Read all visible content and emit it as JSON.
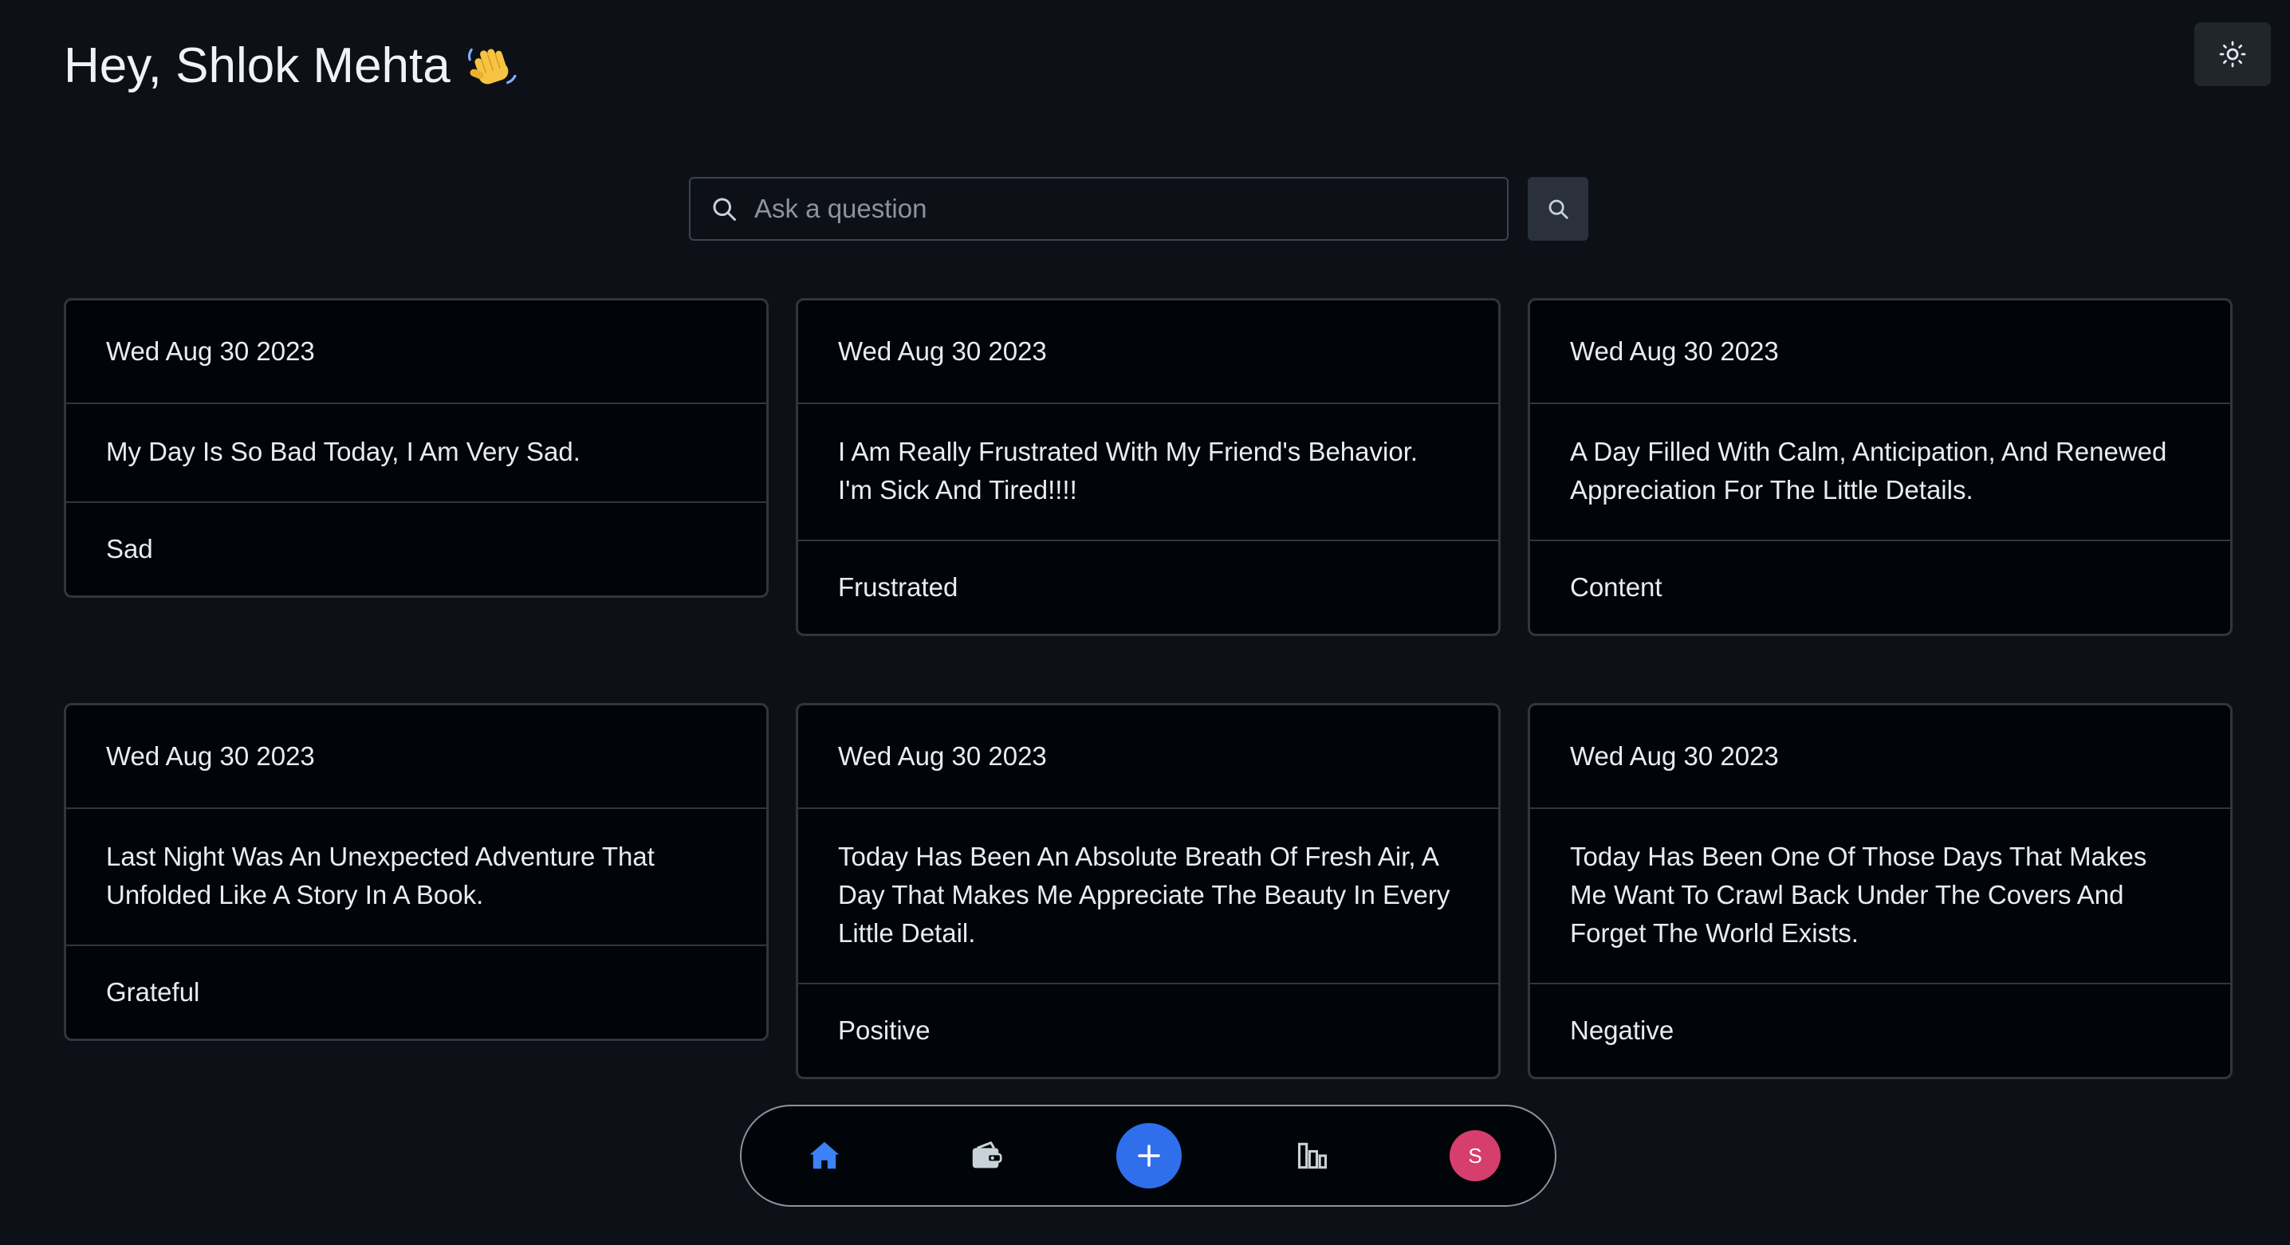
{
  "header": {
    "greeting": "Hey, Shlok Mehta",
    "wave_icon": "waving-hand-icon",
    "theme_toggle_icon": "sun-icon"
  },
  "search": {
    "placeholder": "Ask a question",
    "value": "",
    "input_icon": "search-icon",
    "button_icon": "search-icon"
  },
  "entries": [
    {
      "date": "Wed Aug 30 2023",
      "text": "My Day Is So Bad Today, I Am Very Sad.",
      "mood": "Sad"
    },
    {
      "date": "Wed Aug 30 2023",
      "text": "I Am Really Frustrated With My Friend's Behavior. I'm Sick And Tired!!!!",
      "mood": "Frustrated"
    },
    {
      "date": "Wed Aug 30 2023",
      "text": "A Day Filled With Calm, Anticipation, And Renewed Appreciation For The Little Details.",
      "mood": "Content"
    },
    {
      "date": "Wed Aug 30 2023",
      "text": "Last Night Was An Unexpected Adventure That Unfolded Like A Story In A Book.",
      "mood": "Grateful"
    },
    {
      "date": "Wed Aug 30 2023",
      "text": "Today Has Been An Absolute Breath Of Fresh Air, A Day That Makes Me Appreciate The Beauty In Every Little Detail.",
      "mood": "Positive"
    },
    {
      "date": "Wed Aug 30 2023",
      "text": "Today Has Been One Of Those Days That Makes Me Want To Crawl Back Under The Covers And Forget The World Exists.",
      "mood": "Negative"
    }
  ],
  "nav": {
    "items": [
      "home-icon",
      "wallet-icon",
      "plus-icon",
      "bar-chart-icon",
      "avatar"
    ],
    "active": "home-icon",
    "avatar_initial": "S"
  },
  "colors": {
    "background": "#0d1117",
    "card_background": "#010409",
    "border": "#30363d",
    "accent": "#2f6feb",
    "avatar": "#d63e6d"
  }
}
